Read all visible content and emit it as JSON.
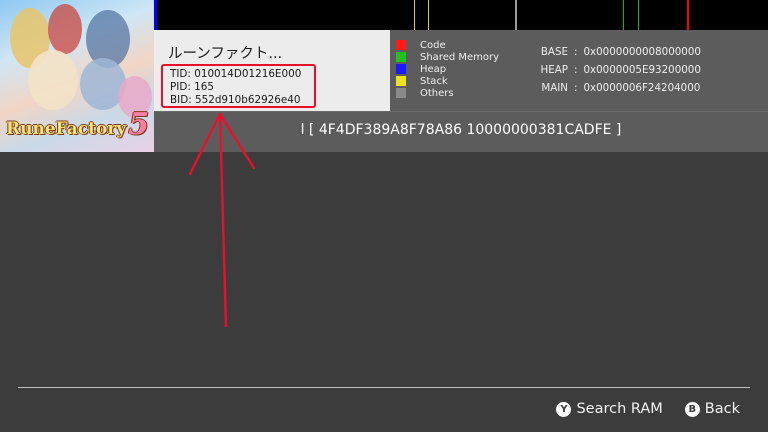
{
  "memory_bar_colors": {
    "code": "#ff0000",
    "heap": "#0000ff",
    "shared": "#00c000",
    "stack": "#e0d000",
    "other": "#808080"
  },
  "game": {
    "art_logo_text": "RuneFactory",
    "art_logo_num": "5",
    "title": "ルーンファクト...",
    "tid": "TID: 010014D01216E000",
    "pid": "PID: 165",
    "bid": "BID: 552d910b62926e40",
    "highlight_color": "#e8102a"
  },
  "legend": [
    {
      "label": "Code",
      "color": "#ff1a1a"
    },
    {
      "label": "Shared Memory",
      "color": "#1ec21e"
    },
    {
      "label": "Heap",
      "color": "#1a1aff"
    },
    {
      "label": "Stack",
      "color": "#f2e01a"
    },
    {
      "label": "Others",
      "color": "#8a8a8a"
    }
  ],
  "addresses": [
    {
      "label": "BASE",
      "value": "0x0000000008000000"
    },
    {
      "label": "HEAP",
      "value": "0x0000005E93200000"
    },
    {
      "label": "MAIN",
      "value": "0x0000006F24204000"
    }
  ],
  "hex_display": "l [ 4F4DF389A8F78A86 10000000381CADFE ]",
  "footer": {
    "search": {
      "glyph": "Y",
      "label": "Search RAM"
    },
    "back": {
      "glyph": "B",
      "label": "Back"
    }
  }
}
